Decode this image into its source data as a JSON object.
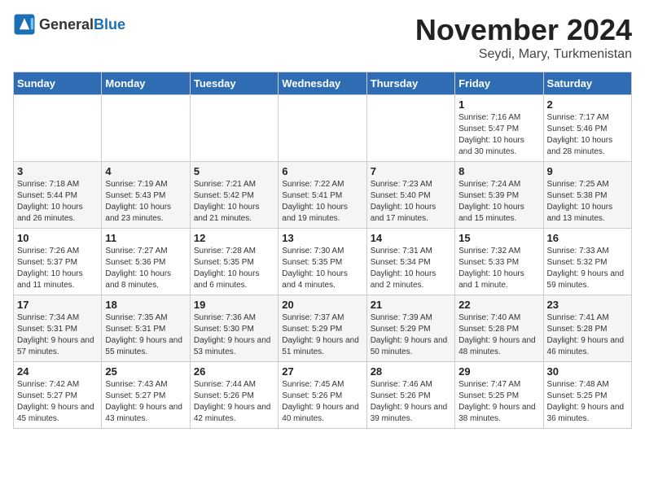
{
  "logo": {
    "text_general": "General",
    "text_blue": "Blue"
  },
  "title": {
    "month": "November 2024",
    "location": "Seydi, Mary, Turkmenistan"
  },
  "weekdays": [
    "Sunday",
    "Monday",
    "Tuesday",
    "Wednesday",
    "Thursday",
    "Friday",
    "Saturday"
  ],
  "weeks": [
    [
      {
        "day": "",
        "info": ""
      },
      {
        "day": "",
        "info": ""
      },
      {
        "day": "",
        "info": ""
      },
      {
        "day": "",
        "info": ""
      },
      {
        "day": "",
        "info": ""
      },
      {
        "day": "1",
        "info": "Sunrise: 7:16 AM\nSunset: 5:47 PM\nDaylight: 10 hours and 30 minutes."
      },
      {
        "day": "2",
        "info": "Sunrise: 7:17 AM\nSunset: 5:46 PM\nDaylight: 10 hours and 28 minutes."
      }
    ],
    [
      {
        "day": "3",
        "info": "Sunrise: 7:18 AM\nSunset: 5:44 PM\nDaylight: 10 hours and 26 minutes."
      },
      {
        "day": "4",
        "info": "Sunrise: 7:19 AM\nSunset: 5:43 PM\nDaylight: 10 hours and 23 minutes."
      },
      {
        "day": "5",
        "info": "Sunrise: 7:21 AM\nSunset: 5:42 PM\nDaylight: 10 hours and 21 minutes."
      },
      {
        "day": "6",
        "info": "Sunrise: 7:22 AM\nSunset: 5:41 PM\nDaylight: 10 hours and 19 minutes."
      },
      {
        "day": "7",
        "info": "Sunrise: 7:23 AM\nSunset: 5:40 PM\nDaylight: 10 hours and 17 minutes."
      },
      {
        "day": "8",
        "info": "Sunrise: 7:24 AM\nSunset: 5:39 PM\nDaylight: 10 hours and 15 minutes."
      },
      {
        "day": "9",
        "info": "Sunrise: 7:25 AM\nSunset: 5:38 PM\nDaylight: 10 hours and 13 minutes."
      }
    ],
    [
      {
        "day": "10",
        "info": "Sunrise: 7:26 AM\nSunset: 5:37 PM\nDaylight: 10 hours and 11 minutes."
      },
      {
        "day": "11",
        "info": "Sunrise: 7:27 AM\nSunset: 5:36 PM\nDaylight: 10 hours and 8 minutes."
      },
      {
        "day": "12",
        "info": "Sunrise: 7:28 AM\nSunset: 5:35 PM\nDaylight: 10 hours and 6 minutes."
      },
      {
        "day": "13",
        "info": "Sunrise: 7:30 AM\nSunset: 5:35 PM\nDaylight: 10 hours and 4 minutes."
      },
      {
        "day": "14",
        "info": "Sunrise: 7:31 AM\nSunset: 5:34 PM\nDaylight: 10 hours and 2 minutes."
      },
      {
        "day": "15",
        "info": "Sunrise: 7:32 AM\nSunset: 5:33 PM\nDaylight: 10 hours and 1 minute."
      },
      {
        "day": "16",
        "info": "Sunrise: 7:33 AM\nSunset: 5:32 PM\nDaylight: 9 hours and 59 minutes."
      }
    ],
    [
      {
        "day": "17",
        "info": "Sunrise: 7:34 AM\nSunset: 5:31 PM\nDaylight: 9 hours and 57 minutes."
      },
      {
        "day": "18",
        "info": "Sunrise: 7:35 AM\nSunset: 5:31 PM\nDaylight: 9 hours and 55 minutes."
      },
      {
        "day": "19",
        "info": "Sunrise: 7:36 AM\nSunset: 5:30 PM\nDaylight: 9 hours and 53 minutes."
      },
      {
        "day": "20",
        "info": "Sunrise: 7:37 AM\nSunset: 5:29 PM\nDaylight: 9 hours and 51 minutes."
      },
      {
        "day": "21",
        "info": "Sunrise: 7:39 AM\nSunset: 5:29 PM\nDaylight: 9 hours and 50 minutes."
      },
      {
        "day": "22",
        "info": "Sunrise: 7:40 AM\nSunset: 5:28 PM\nDaylight: 9 hours and 48 minutes."
      },
      {
        "day": "23",
        "info": "Sunrise: 7:41 AM\nSunset: 5:28 PM\nDaylight: 9 hours and 46 minutes."
      }
    ],
    [
      {
        "day": "24",
        "info": "Sunrise: 7:42 AM\nSunset: 5:27 PM\nDaylight: 9 hours and 45 minutes."
      },
      {
        "day": "25",
        "info": "Sunrise: 7:43 AM\nSunset: 5:27 PM\nDaylight: 9 hours and 43 minutes."
      },
      {
        "day": "26",
        "info": "Sunrise: 7:44 AM\nSunset: 5:26 PM\nDaylight: 9 hours and 42 minutes."
      },
      {
        "day": "27",
        "info": "Sunrise: 7:45 AM\nSunset: 5:26 PM\nDaylight: 9 hours and 40 minutes."
      },
      {
        "day": "28",
        "info": "Sunrise: 7:46 AM\nSunset: 5:26 PM\nDaylight: 9 hours and 39 minutes."
      },
      {
        "day": "29",
        "info": "Sunrise: 7:47 AM\nSunset: 5:25 PM\nDaylight: 9 hours and 38 minutes."
      },
      {
        "day": "30",
        "info": "Sunrise: 7:48 AM\nSunset: 5:25 PM\nDaylight: 9 hours and 36 minutes."
      }
    ]
  ]
}
